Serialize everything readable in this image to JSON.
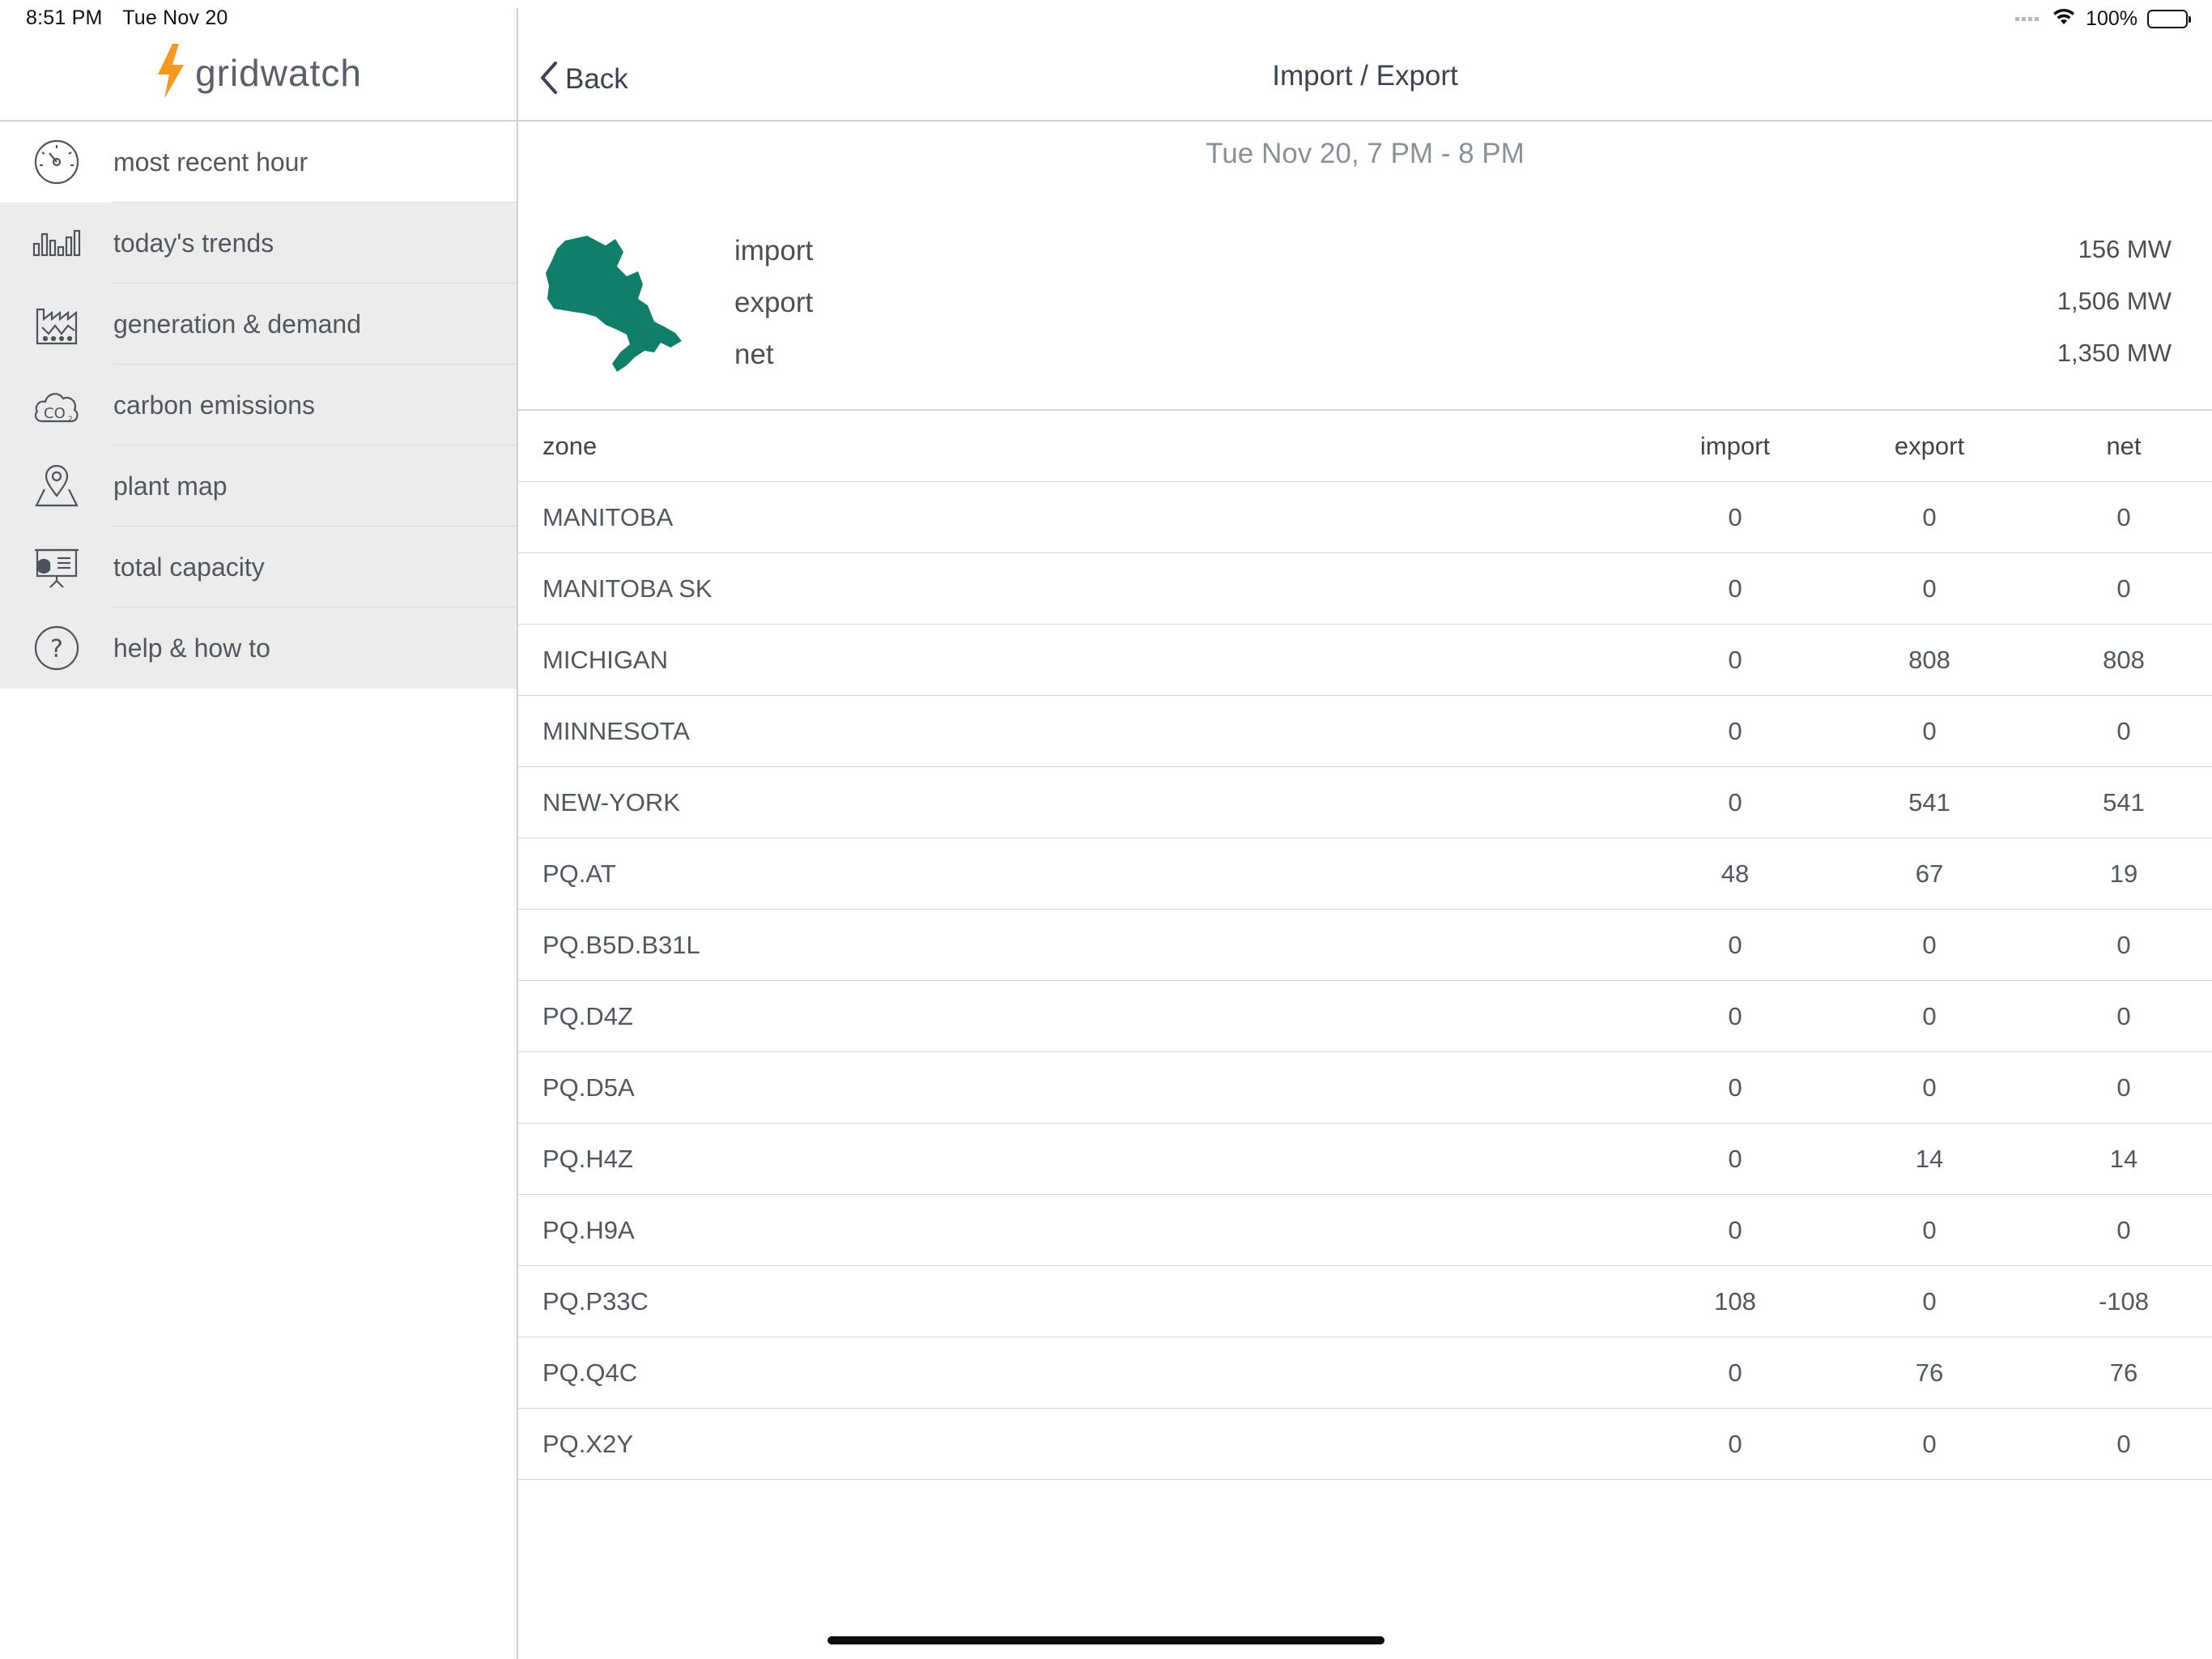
{
  "status_bar": {
    "time": "8:51 PM",
    "date": "Tue Nov 20",
    "battery_text": "100%"
  },
  "app": {
    "brand_name": "gridwatch",
    "accent_color": "#f39a1f",
    "map_color": "#107f6a"
  },
  "sidebar": {
    "items": [
      {
        "label": "most recent hour",
        "icon": "speedometer-icon"
      },
      {
        "label": "today's trends",
        "icon": "bar-chart-icon"
      },
      {
        "label": "generation & demand",
        "icon": "factory-icon"
      },
      {
        "label": "carbon emissions",
        "icon": "co2-cloud-icon"
      },
      {
        "label": "plant map",
        "icon": "map-pin-icon"
      },
      {
        "label": "total capacity",
        "icon": "presentation-icon"
      },
      {
        "label": "help & how to",
        "icon": "help-icon"
      }
    ]
  },
  "navbar": {
    "back_label": "Back",
    "title": "Import / Export"
  },
  "period": "Tue Nov 20, 7 PM - 8 PM",
  "summary": {
    "import_label": "import",
    "import_value": "156 MW",
    "export_label": "export",
    "export_value": "1,506 MW",
    "net_label": "net",
    "net_value": "1,350 MW"
  },
  "table": {
    "headers": {
      "zone": "zone",
      "import": "import",
      "export": "export",
      "net": "net"
    },
    "rows": [
      {
        "zone": "MANITOBA",
        "import": "0",
        "export": "0",
        "net": "0"
      },
      {
        "zone": "MANITOBA SK",
        "import": "0",
        "export": "0",
        "net": "0"
      },
      {
        "zone": "MICHIGAN",
        "import": "0",
        "export": "808",
        "net": "808"
      },
      {
        "zone": "MINNESOTA",
        "import": "0",
        "export": "0",
        "net": "0"
      },
      {
        "zone": "NEW-YORK",
        "import": "0",
        "export": "541",
        "net": "541"
      },
      {
        "zone": "PQ.AT",
        "import": "48",
        "export": "67",
        "net": "19"
      },
      {
        "zone": "PQ.B5D.B31L",
        "import": "0",
        "export": "0",
        "net": "0"
      },
      {
        "zone": "PQ.D4Z",
        "import": "0",
        "export": "0",
        "net": "0"
      },
      {
        "zone": "PQ.D5A",
        "import": "0",
        "export": "0",
        "net": "0"
      },
      {
        "zone": "PQ.H4Z",
        "import": "0",
        "export": "14",
        "net": "14"
      },
      {
        "zone": "PQ.H9A",
        "import": "0",
        "export": "0",
        "net": "0"
      },
      {
        "zone": "PQ.P33C",
        "import": "108",
        "export": "0",
        "net": "-108"
      },
      {
        "zone": "PQ.Q4C",
        "import": "0",
        "export": "76",
        "net": "76"
      },
      {
        "zone": "PQ.X2Y",
        "import": "0",
        "export": "0",
        "net": "0"
      }
    ]
  }
}
